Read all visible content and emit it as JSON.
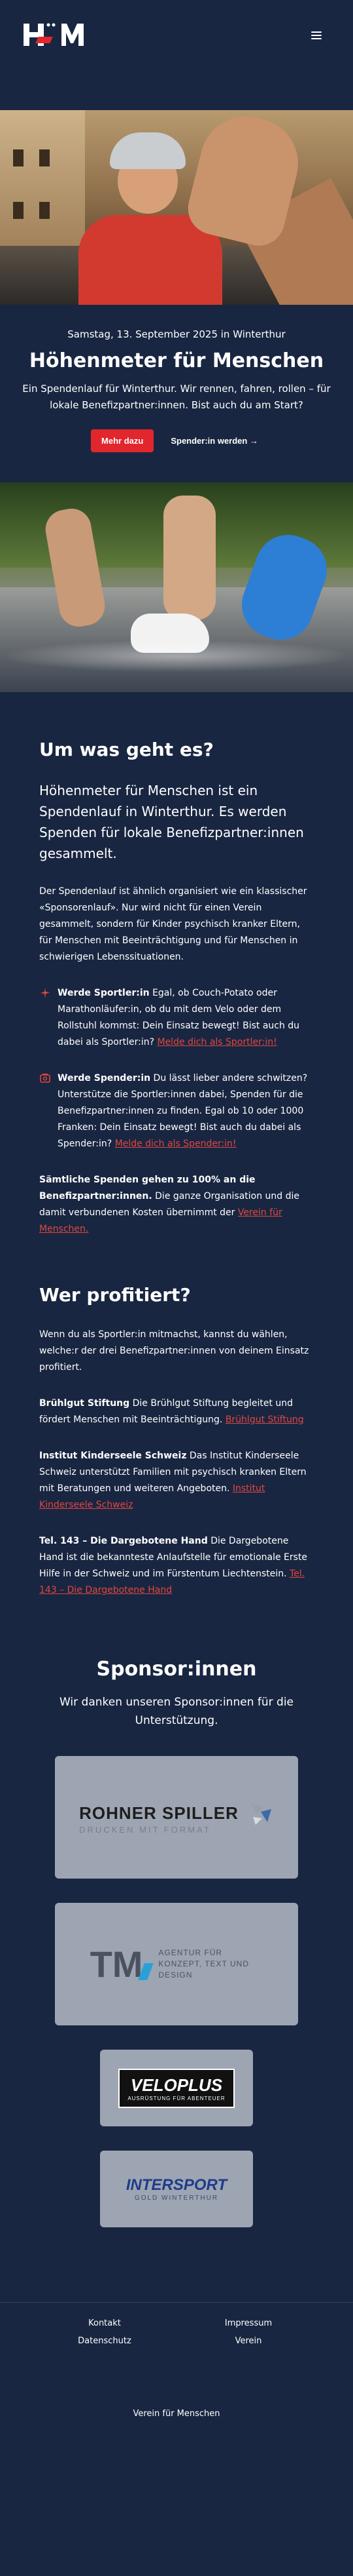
{
  "header": {
    "logo_text": "HöM",
    "menu_icon": "hamburger-menu-icon"
  },
  "hero": {
    "date": "Samstag, 13. September 2025 in Winterthur",
    "title": "Höhenmeter für Menschen",
    "subtitle": "Ein Spendenlauf für Winterthur. Wir rennen, fahren, rollen – für lokale Benefizpartner:innen. Bist auch du am Start?",
    "primary_button": "Mehr dazu",
    "secondary_button": "Spender:in werden →"
  },
  "about": {
    "title": "Um was geht es?",
    "lead": "Höhenmeter für Menschen ist ein Spendenlauf in Winterthur. Es werden Spenden für lokale Benefizpartner:innen gesammelt.",
    "body": "Der Spendenlauf ist ähnlich organisiert wie ein klassischer «Sponsorenlauf». Nur wird nicht für einen Verein gesammelt, sondern für Kinder psychisch kranker Eltern, für Menschen mit Beeinträchtigung und für Menschen in schwierigen Lebenssituationen.",
    "sportler": {
      "icon": "runner-icon",
      "title": "Werde Sportler:in",
      "text": " Egal, ob Couch-Potato oder Marathonläufer:in, ob du mit dem Velo oder dem Rollstuhl kommst: Dein Einsatz bewegt! Bist auch du dabei als Sportler:in? ",
      "link": "Melde dich als Sportler:in!"
    },
    "spender": {
      "icon": "donation-icon",
      "title": "Werde Spender:in",
      "text": " Du lässt lieber andere schwitzen? Unterstütze die Sportler:innen dabei, Spenden für die Benefizpartner:innen zu finden. Egal ob 10 oder 1000 Franken: Dein Einsatz bewegt! Bist auch du dabei als Spender:in? ",
      "link": "Melde dich als Spender:in!"
    },
    "all_bold": "Sämtliche Spenden gehen zu 100% an die Benefizpartner:innen.",
    "all_text": " Die ganze Organisation und die damit verbundenen Kosten übernimmt der ",
    "all_link": "Verein für Menschen."
  },
  "beneficiaries": {
    "title": "Wer profitiert?",
    "intro": "Wenn du als Sportler:in mitmachst, kannst du wählen, welche:r der drei Benefizpartner:innen von deinem Einsatz profitiert.",
    "items": [
      {
        "name": "Brühlgut Stiftung",
        "text": " Die Brühlgut Stiftung begleitet und fördert Menschen mit Beeinträchtigung. ",
        "link": "Brühlgut Stiftung"
      },
      {
        "name": "Institut Kinderseele Schweiz",
        "text": " Das Institut Kinderseele Schweiz unterstützt Familien mit psychisch kranken Eltern mit Beratungen und weiteren Angeboten. ",
        "link": "Institut Kinderseele Schweiz"
      },
      {
        "name": "Tel. 143 – Die Dargebotene Hand",
        "text": " Die Dargebotene Hand ist die bekannteste Anlaufstelle für emotionale Erste Hilfe in der Schweiz und im Fürstentum Liechtenstein. ",
        "link": "Tel. 143 – Die Dargebotene Hand"
      }
    ]
  },
  "sponsors": {
    "title": "Sponsor:innen",
    "text": "Wir danken unseren Sponsor:innen für die Unterstützung.",
    "logos": [
      {
        "line1": "ROHNER SPILLER",
        "line2": "DRUCKEN MIT FORMAT"
      },
      {
        "line1": "TM",
        "line2": "AGENTUR FÜR KONZEPT, TEXT UND DESIGN"
      },
      {
        "line1": "VELOPLUS",
        "line2": "AUSRÜSTUNG FÜR ABENTEUER"
      },
      {
        "line1": "INTERSPORT",
        "line2": "GOLD WINTERTHUR"
      }
    ]
  },
  "footer": {
    "links": [
      "Kontakt",
      "Impressum",
      "Datenschutz",
      "Verein"
    ],
    "bottom": "Verein für Menschen"
  }
}
